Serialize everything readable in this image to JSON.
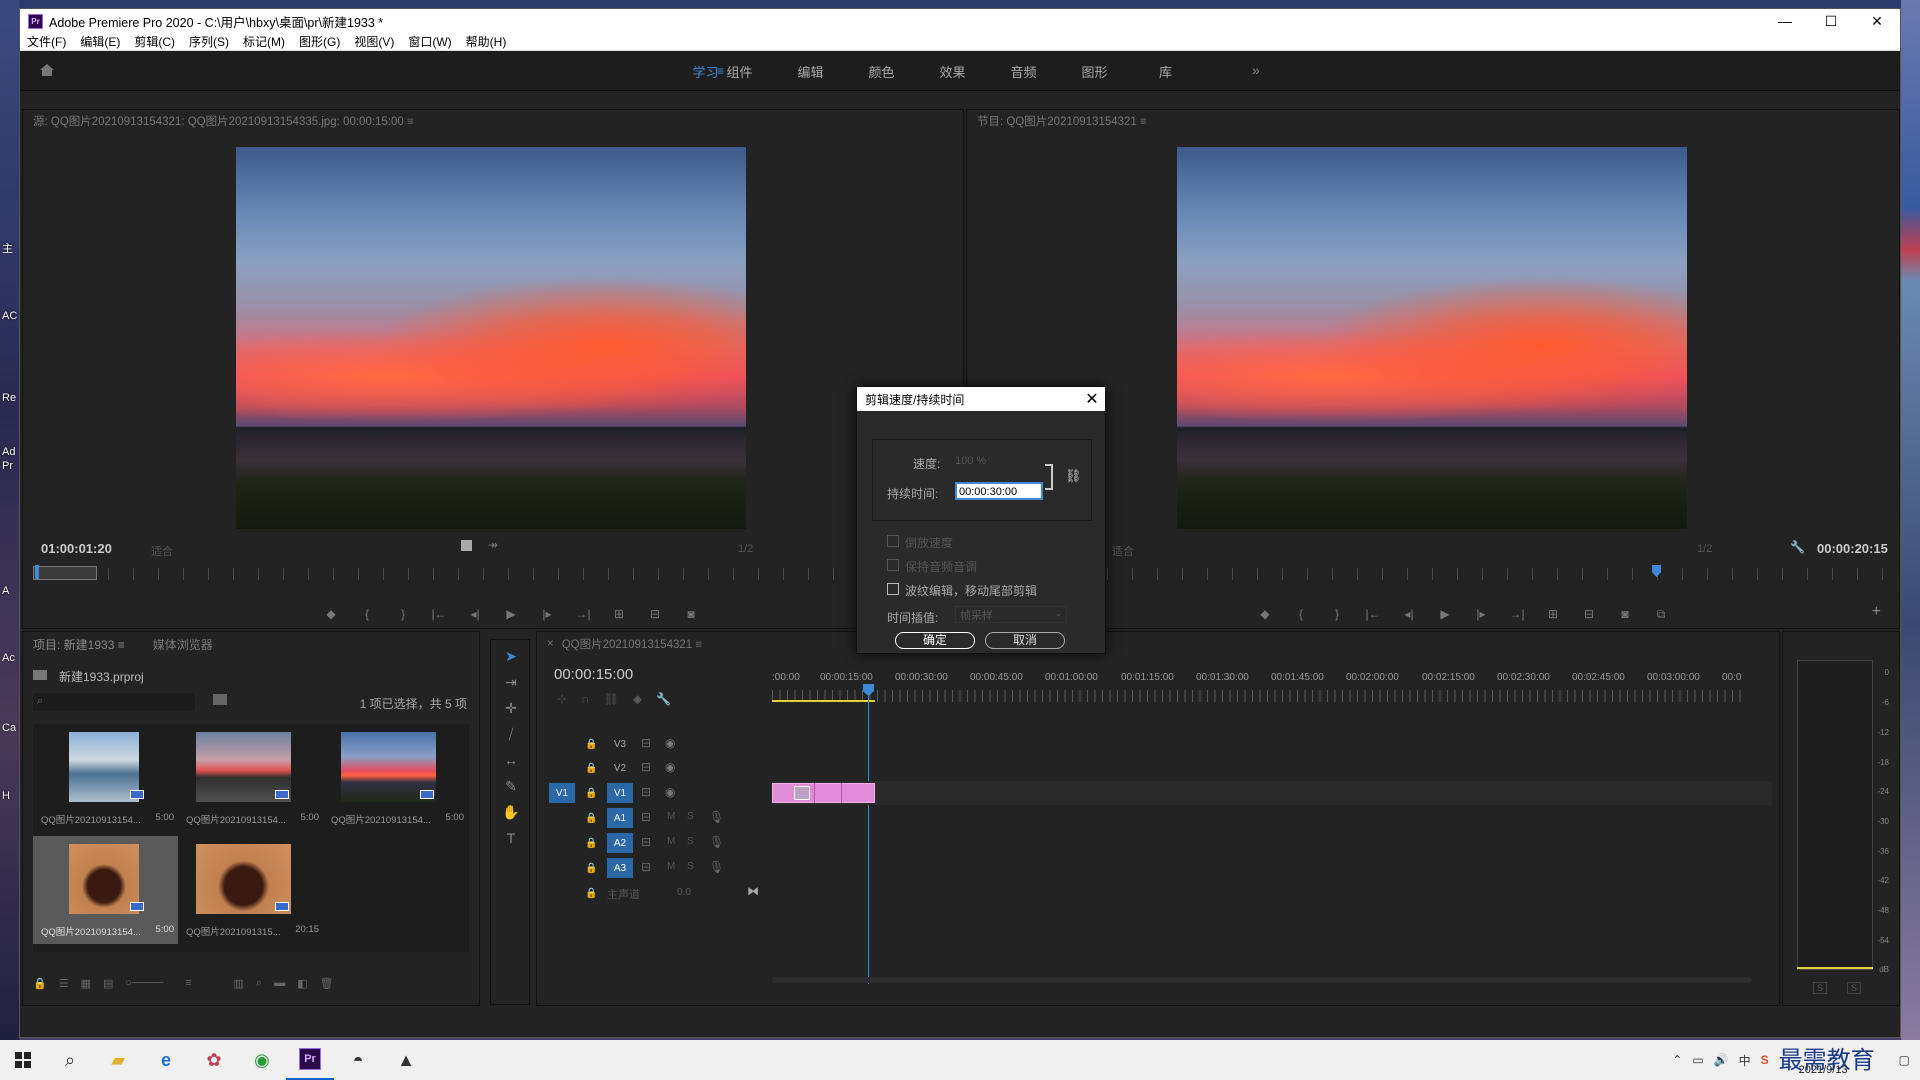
{
  "window": {
    "title": "Adobe Premiere Pro 2020 - C:\\用户\\hbxy\\桌面\\pr\\新建1933 *",
    "logo": "Pr"
  },
  "menu": [
    "文件(F)",
    "编辑(E)",
    "剪辑(C)",
    "序列(S)",
    "标记(M)",
    "图形(G)",
    "视图(V)",
    "窗口(W)",
    "帮助(H)"
  ],
  "workspaces": [
    "学习",
    "组件",
    "编辑",
    "颜色",
    "效果",
    "音频",
    "图形",
    "库"
  ],
  "source_monitor": {
    "header": "源: QQ图片20210913154321: QQ图片20210913154335.jpg: 00:00:15:00  ≡",
    "timecode": "01:00:01:20",
    "fit": "适合",
    "res": "1/2"
  },
  "program_monitor": {
    "header": "节目: QQ图片20210913154321  ≡",
    "timecode": "00:00:20:15",
    "fit": "适合",
    "res": "1/2"
  },
  "project": {
    "tab1": "项目: 新建1933  ≡",
    "tab2": "媒体浏览器",
    "file": "新建1933.prproj",
    "selection": "1 项已选择，共 5 项",
    "items": [
      {
        "name": "QQ图片20210913154...",
        "dur": "5:00"
      },
      {
        "name": "QQ图片20210913154...",
        "dur": "5:00"
      },
      {
        "name": "QQ图片20210913154...",
        "dur": "5:00"
      },
      {
        "name": "QQ图片20210913154...",
        "dur": "5:00"
      },
      {
        "name": "QQ图片2021091315...",
        "dur": "20:15"
      }
    ]
  },
  "timeline": {
    "tab": "QQ图片20210913154321  ≡",
    "timecode": "00:00:15:00",
    "ruler": [
      ":00:00",
      "00:00:15:00",
      "00:00:30:00",
      "00:00:45:00",
      "00:01:00:00",
      "00:01:15:00",
      "00:01:30:00",
      "00:01:45:00",
      "00:02:00:00",
      "00:02:15:00",
      "00:02:30:00",
      "00:02:45:00",
      "00:03:00:00",
      "00:0"
    ],
    "video_tracks": [
      "V3",
      "V2",
      "V1"
    ],
    "audio_tracks": [
      "A1",
      "A2",
      "A3"
    ],
    "master": "主声道",
    "master_val": "0.0",
    "src_v": "V1",
    "mute": "M",
    "solo": "S"
  },
  "dialog": {
    "title": "剪辑速度/持续时间",
    "speed_label": "速度:",
    "speed_value": "100 %",
    "duration_label": "持续时间:",
    "duration_value": "00:00:30:00",
    "reverse": "倒放速度",
    "keep_pitch": "保持音频音调",
    "ripple": "波纹编辑，移动尾部剪辑",
    "interp_label": "时间插值:",
    "interp_value": "帧采样",
    "ok": "确定",
    "cancel": "取消"
  },
  "meter": {
    "scale": [
      "0",
      "-6",
      "-12",
      "-18",
      "-24",
      "-30",
      "-36",
      "-42",
      "-48",
      "-54",
      "dB"
    ],
    "solo": "S"
  },
  "desktop": {
    "left_labels": [
      "主",
      "AC",
      "Re",
      "Ad",
      "Pr",
      "A",
      "Ac",
      "Ca",
      "H"
    ]
  },
  "taskbar": {
    "icons": [
      "windows-icon",
      "search-icon",
      "explorer-icon",
      "edge-icon",
      "app1-icon",
      "chrome-icon",
      "premiere-icon",
      "photos-icon",
      "image-viewer-icon"
    ],
    "date": "2021/9/13",
    "watermark": "最需教育",
    "ime": "中"
  }
}
